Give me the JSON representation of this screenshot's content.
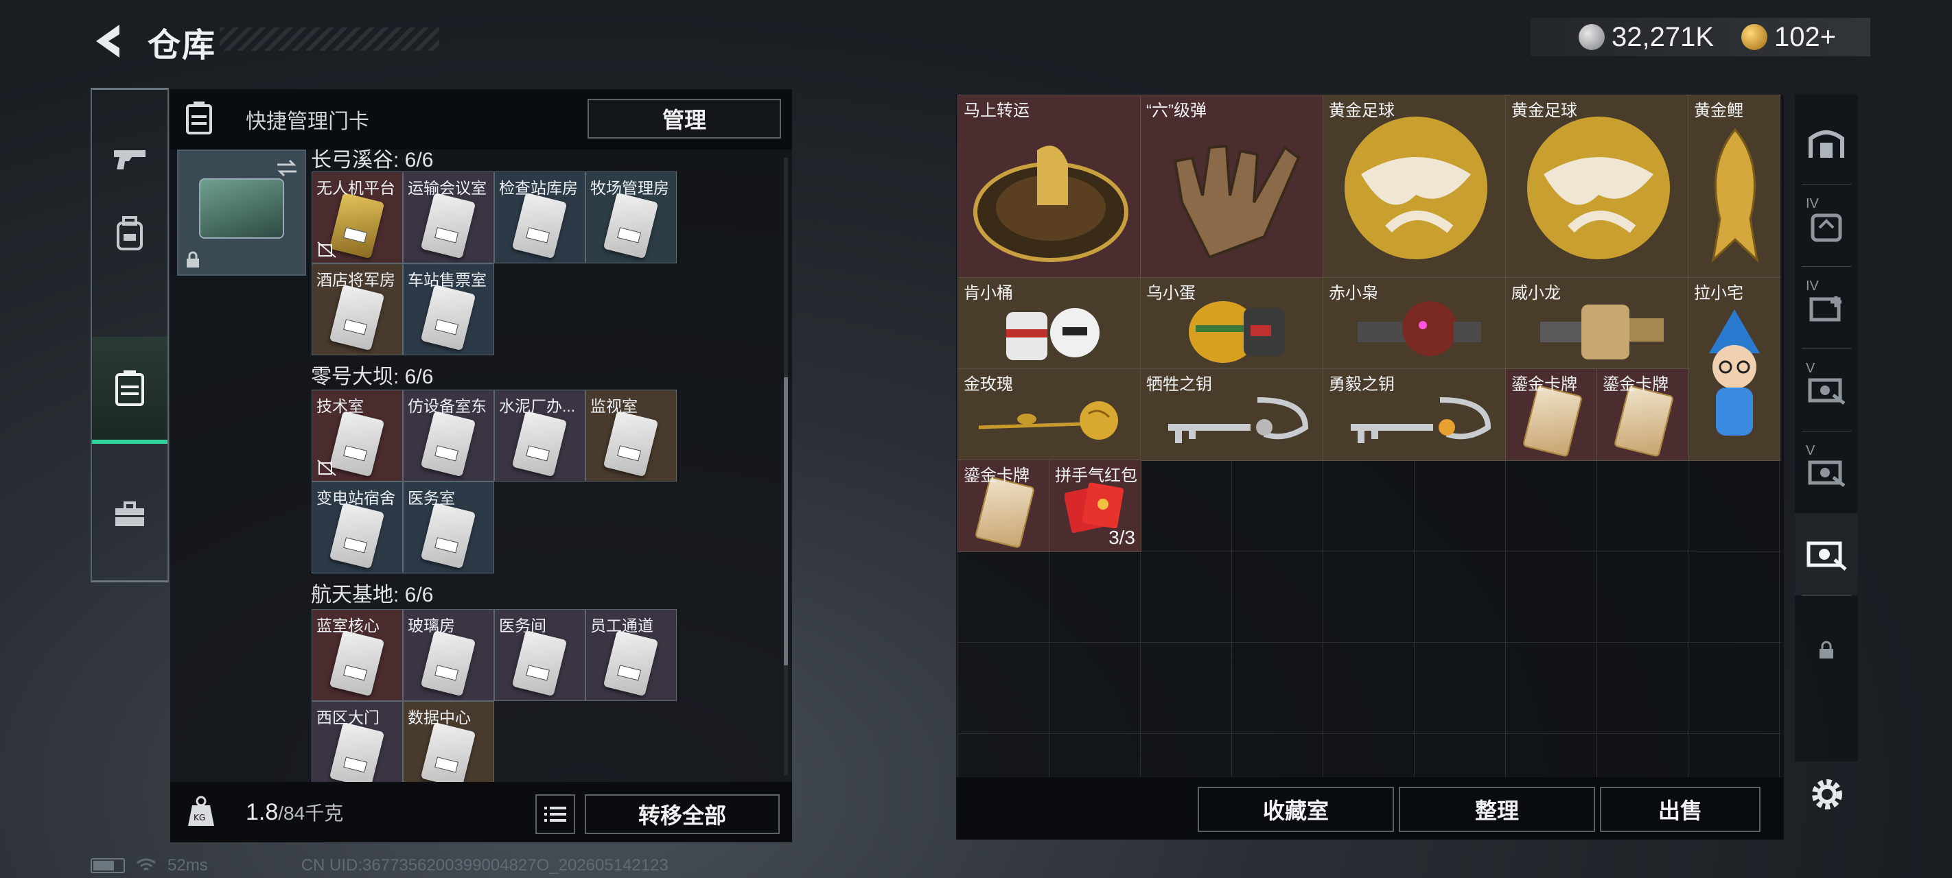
{
  "header": {
    "title": "仓库"
  },
  "currency": {
    "coins": "32,271K",
    "premium": "102+"
  },
  "left_panel": {
    "header_label": "快捷管理门卡",
    "manage_label": "管理",
    "groups": [
      {
        "title": "长弓溪谷: 6/6",
        "keys": [
          {
            "name": "无人机平台",
            "color": "red"
          },
          {
            "name": "运输会议室",
            "color": "purple"
          },
          {
            "name": "检查站库房",
            "color": "blue"
          },
          {
            "name": "牧场管理房",
            "color": "teal"
          },
          {
            "name": "酒店将军房",
            "color": "brown"
          },
          {
            "name": "车站售票室",
            "color": "blue"
          }
        ]
      },
      {
        "title": "零号大坝: 6/6",
        "keys": [
          {
            "name": "技术室",
            "color": "red"
          },
          {
            "name": "仿设备室东",
            "color": "purple"
          },
          {
            "name": "水泥厂办...",
            "color": "purple"
          },
          {
            "name": "监视室",
            "color": "brown"
          },
          {
            "name": "变电站宿舍",
            "color": "blue"
          },
          {
            "name": "医务室",
            "color": "blue"
          }
        ]
      },
      {
        "title": "航天基地: 6/6",
        "keys": [
          {
            "name": "蓝室核心",
            "color": "red"
          },
          {
            "name": "玻璃房",
            "color": "purple"
          },
          {
            "name": "医务间",
            "color": "purple"
          },
          {
            "name": "员工通道",
            "color": "purple"
          },
          {
            "name": "西区大门",
            "color": "purple"
          },
          {
            "name": "数据中心",
            "color": "brown"
          }
        ]
      }
    ],
    "weight_current": "1.8",
    "weight_max": "/84千克",
    "transfer_label": "转移全部"
  },
  "inventory": [
    {
      "name": "马上转运",
      "bg": "red"
    },
    {
      "name": "“六”级弹",
      "bg": "red"
    },
    {
      "name": "黄金足球",
      "bg": "gold"
    },
    {
      "name": "黄金足球",
      "bg": "gold"
    },
    {
      "name": "黄金鲤",
      "bg": "gold"
    },
    {
      "name": "肯小桶",
      "bg": "gold"
    },
    {
      "name": "乌小蛋",
      "bg": "gold"
    },
    {
      "name": "赤小枭",
      "bg": "gold"
    },
    {
      "name": "威小龙",
      "bg": "gold"
    },
    {
      "name": "拉小宅",
      "bg": "gold"
    },
    {
      "name": "金玫瑰",
      "bg": "gold"
    },
    {
      "name": "牺牲之钥",
      "bg": "gold"
    },
    {
      "name": "勇毅之钥",
      "bg": "gold"
    },
    {
      "name": "鎏金卡牌",
      "bg": "red"
    },
    {
      "name": "鎏金卡牌",
      "bg": "red"
    },
    {
      "name": "鎏金卡牌",
      "bg": "red"
    },
    {
      "name": "拼手气红包",
      "bg": "red",
      "qty": "3/3"
    }
  ],
  "right_footer": {
    "collection": "收藏室",
    "sort": "整理",
    "sell": "出售"
  },
  "right_rail": {
    "tier_labels": [
      "IV",
      "IV",
      "V",
      "V"
    ]
  },
  "status": {
    "ping": "52ms",
    "uid": "CN UID:3677356200399004827O_202605142123"
  },
  "colors": {
    "accent": "#2fd49a",
    "red_cell": "#4c2d2f",
    "gold_cell": "#4a3c2b"
  }
}
